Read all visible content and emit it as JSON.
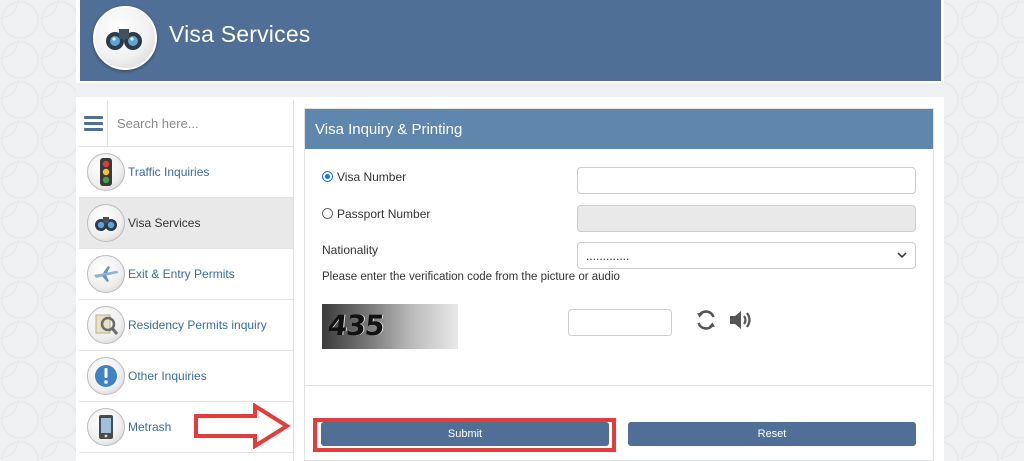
{
  "header": {
    "title": "Visa Services"
  },
  "sidebar": {
    "search_placeholder": "Search here...",
    "items": [
      {
        "label": "Traffic Inquiries",
        "icon": "traffic-light-icon"
      },
      {
        "label": "Visa Services",
        "icon": "visa-services-icon",
        "active": true
      },
      {
        "label": "Exit & Entry Permits",
        "icon": "airplane-icon"
      },
      {
        "label": "Residency Permits inquiry",
        "icon": "magnifier-icon"
      },
      {
        "label": "Other Inquiries",
        "icon": "info-exclamation-icon"
      },
      {
        "label": "Metrash",
        "icon": "phone-icon"
      }
    ]
  },
  "form": {
    "title": "Visa Inquiry & Printing",
    "visa_number_label": "Visa Number",
    "passport_number_label": "Passport Number",
    "nationality_label": "Nationality",
    "nationality_value": ".............",
    "verification_text": "Please enter the verification code from the picture or audio",
    "captcha_text": "435",
    "submit_label": "Submit",
    "reset_label": "Reset"
  },
  "colors": {
    "header": "#4f6f96",
    "panel_head": "#5f86ad",
    "button": "#4f6f96",
    "link": "#3a6d9e",
    "highlight": "#e43b3b"
  }
}
